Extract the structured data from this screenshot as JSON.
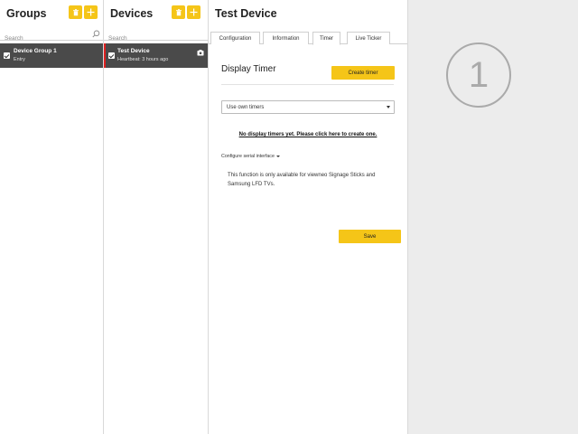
{
  "groups": {
    "title": "Groups",
    "search_placeholder": "Search",
    "items": [
      {
        "title": "Device Group 1",
        "subtitle": "Entry",
        "checked": true
      }
    ]
  },
  "devices": {
    "title": "Devices",
    "search_placeholder": "Search",
    "items": [
      {
        "title": "Test Device",
        "subtitle": "Heartbeat: 3 hours ago",
        "checked": true,
        "status_color": "#e02020"
      }
    ]
  },
  "main": {
    "title": "Test Device",
    "tabs": [
      {
        "label": "Configuration",
        "active": false
      },
      {
        "label": "Information",
        "active": false
      },
      {
        "label": "Timer",
        "active": true
      },
      {
        "label": "Live Ticker",
        "active": false
      }
    ],
    "section_title": "Display Timer",
    "create_timer_label": "Create timer",
    "select_value": "Use own timers",
    "create_link": "No display timers yet. Please click here to create one.",
    "config_toggle": "Configure serial interface",
    "info_text": "This function is only available for viewneo Signage Sticks and Samsung LFD TVs.",
    "save_label": "Save"
  },
  "right": {
    "step_number": "1"
  },
  "colors": {
    "accent": "#f5c518",
    "selected_row": "#4a4a4a",
    "panel_bg": "#ececec"
  },
  "icons": [
    "trash-icon",
    "plus-icon",
    "search-icon",
    "check-icon",
    "device-icon",
    "caret-down-icon"
  ]
}
